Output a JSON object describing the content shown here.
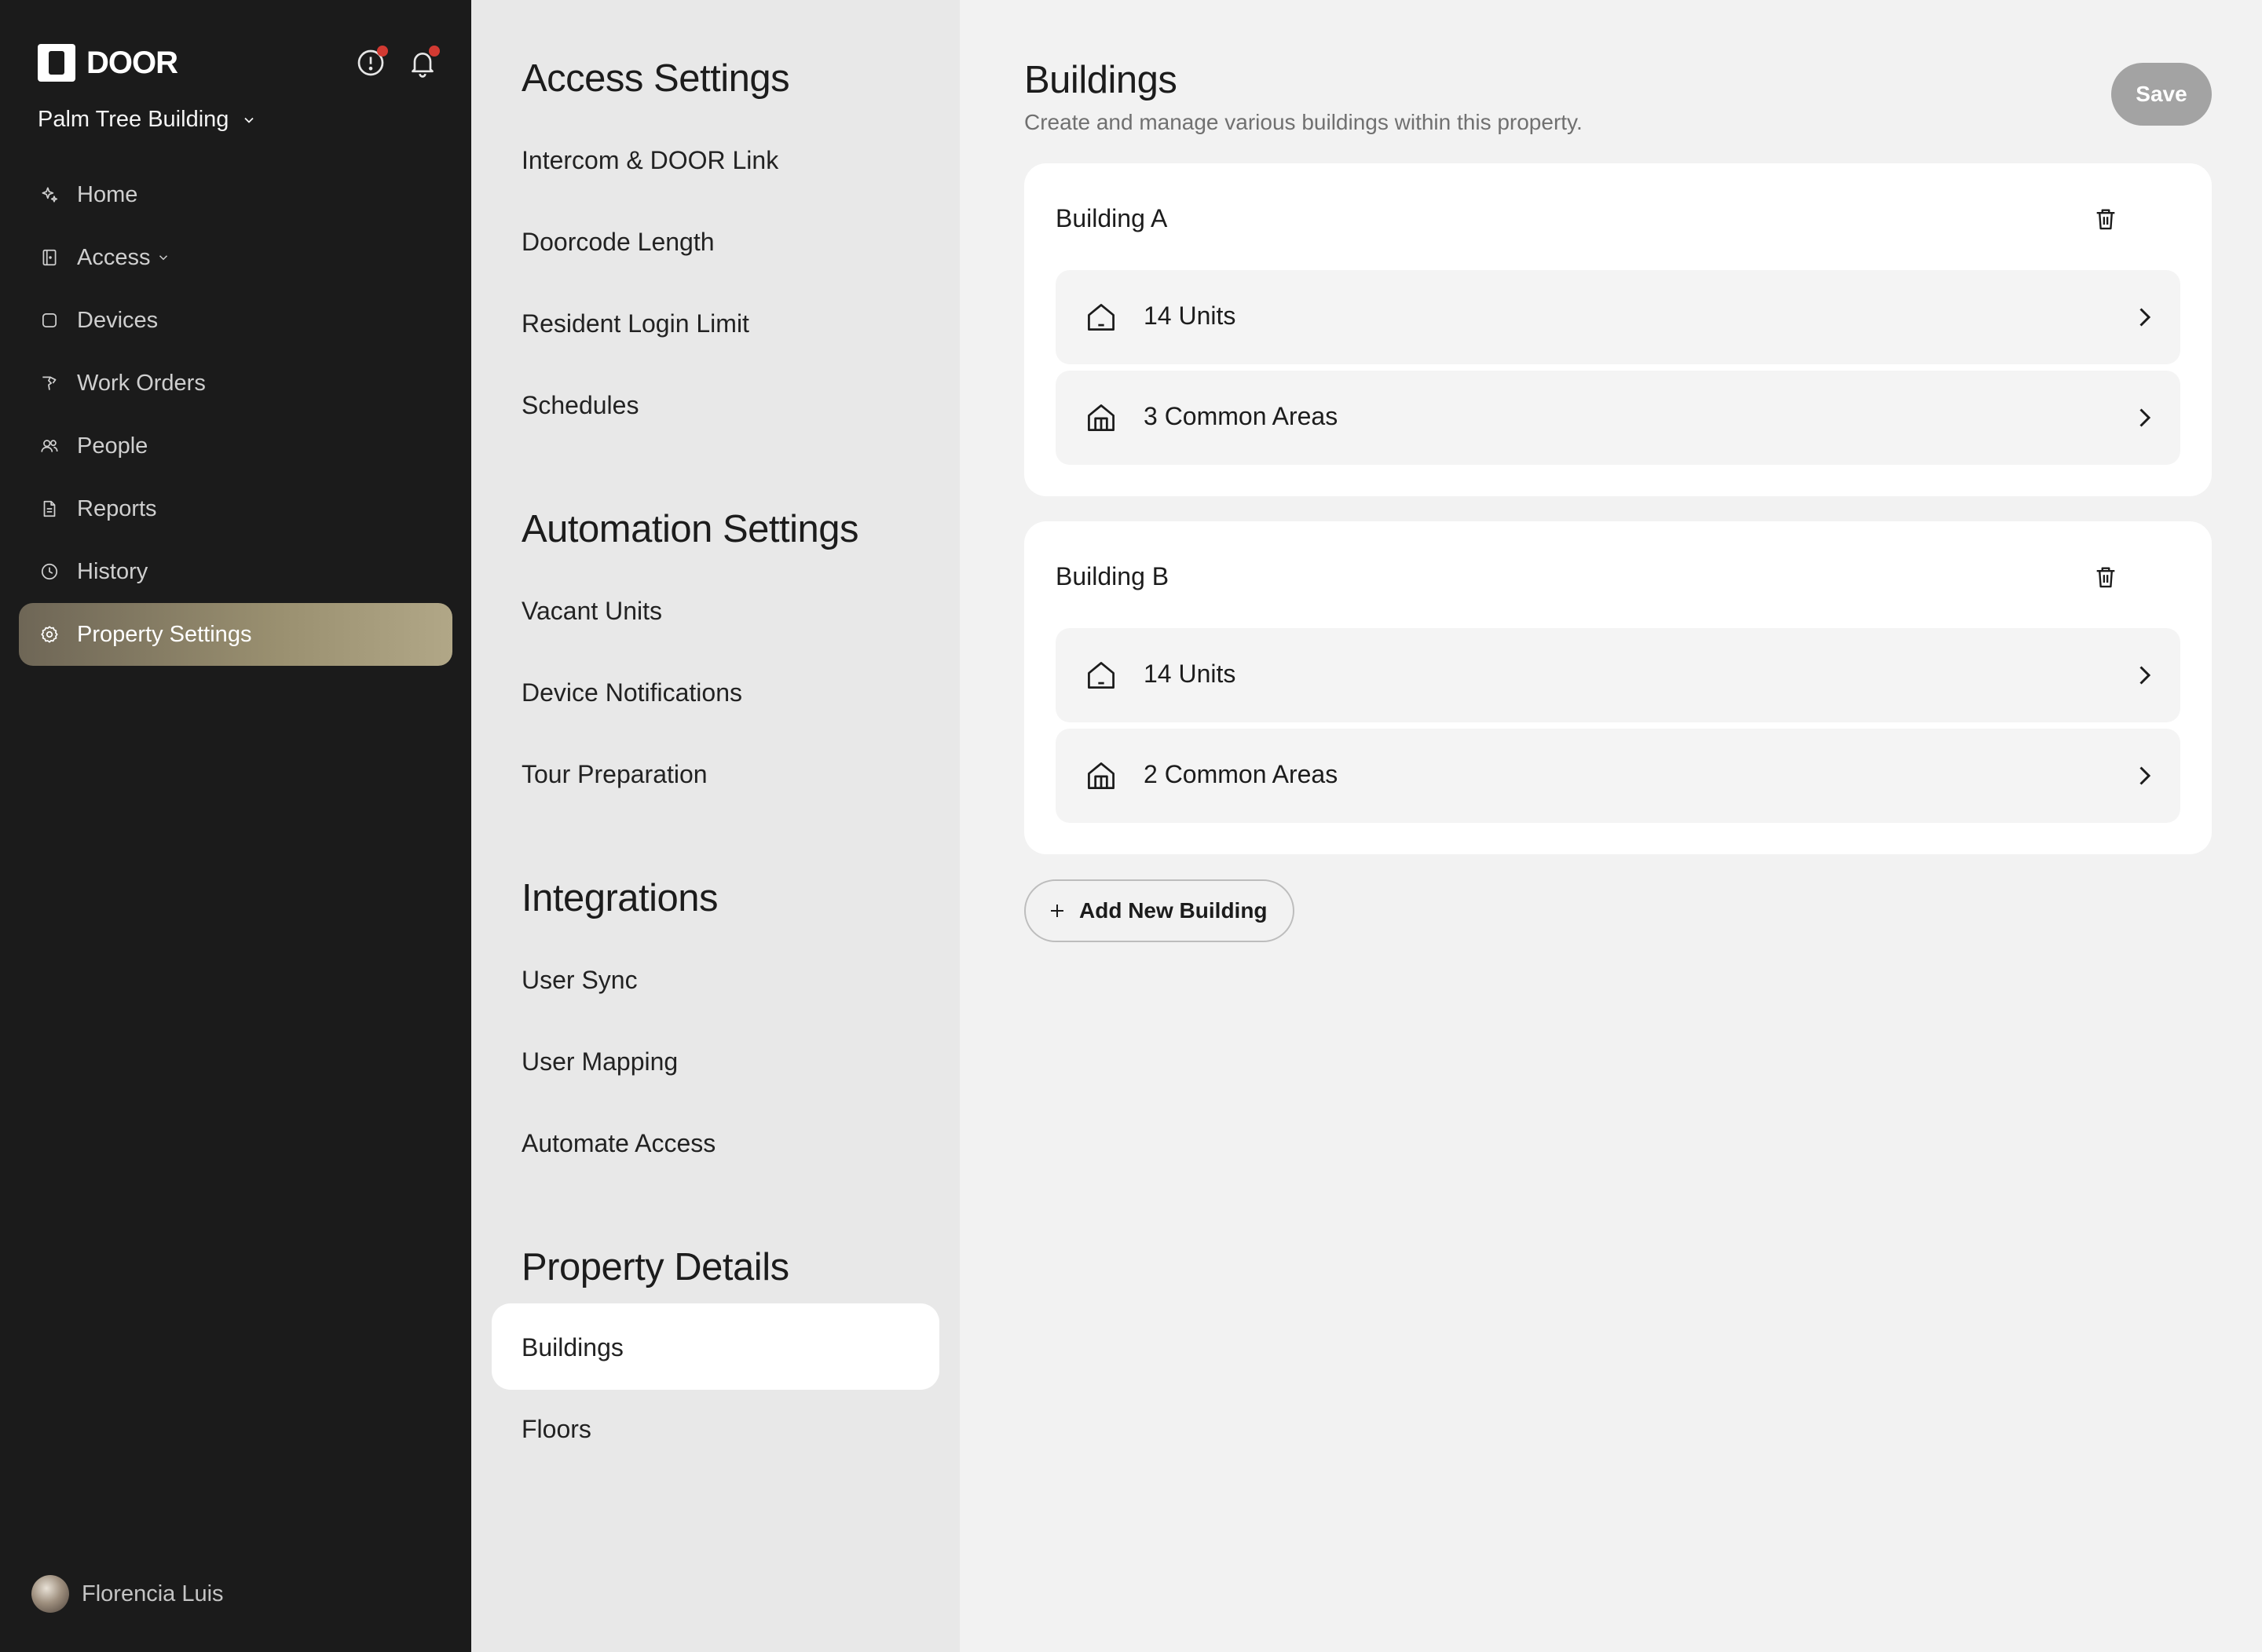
{
  "brand": {
    "name": "DOOR"
  },
  "property": {
    "name": "Palm Tree Building"
  },
  "nav": {
    "items": [
      {
        "label": "Home",
        "icon": "sparkle-icon"
      },
      {
        "label": "Access",
        "icon": "door-icon"
      },
      {
        "label": "Devices",
        "icon": "device-icon"
      },
      {
        "label": "Work Orders",
        "icon": "wrench-icon"
      },
      {
        "label": "People",
        "icon": "people-icon"
      },
      {
        "label": "Reports",
        "icon": "document-icon"
      },
      {
        "label": "History",
        "icon": "clock-icon"
      },
      {
        "label": "Property Settings",
        "icon": "gear-icon",
        "active": true
      }
    ]
  },
  "user": {
    "name": "Florencia Luis"
  },
  "settings_nav": {
    "sections": [
      {
        "title": "Access Settings",
        "links": [
          "Intercom & DOOR Link",
          "Doorcode Length",
          "Resident Login Limit",
          "Schedules"
        ]
      },
      {
        "title": "Automation Settings",
        "links": [
          "Vacant Units",
          "Device Notifications",
          "Tour Preparation"
        ]
      },
      {
        "title": "Integrations",
        "links": [
          "User Sync",
          "User Mapping",
          "Automate Access"
        ]
      },
      {
        "title": "Property Details",
        "links": [
          "Buildings",
          "Floors"
        ]
      }
    ],
    "active": "Buildings"
  },
  "main": {
    "title": "Buildings",
    "subtitle": "Create and manage various buildings within this property.",
    "save_label": "Save",
    "add_building_label": "Add New Building",
    "buildings": [
      {
        "name": "Building A",
        "rows": [
          {
            "label": "14 Units",
            "icon": "house-icon"
          },
          {
            "label": "3 Common Areas",
            "icon": "building-icon"
          }
        ]
      },
      {
        "name": "Building B",
        "rows": [
          {
            "label": "14 Units",
            "icon": "house-icon"
          },
          {
            "label": "2 Common Areas",
            "icon": "building-icon"
          }
        ]
      }
    ]
  },
  "colors": {
    "sidebar_bg": "#1b1b1b",
    "active_gradient_start": "#6e6656",
    "active_gradient_end": "#b1a787",
    "notification_dot": "#d23a32",
    "save_disabled": "#a3a3a3"
  }
}
